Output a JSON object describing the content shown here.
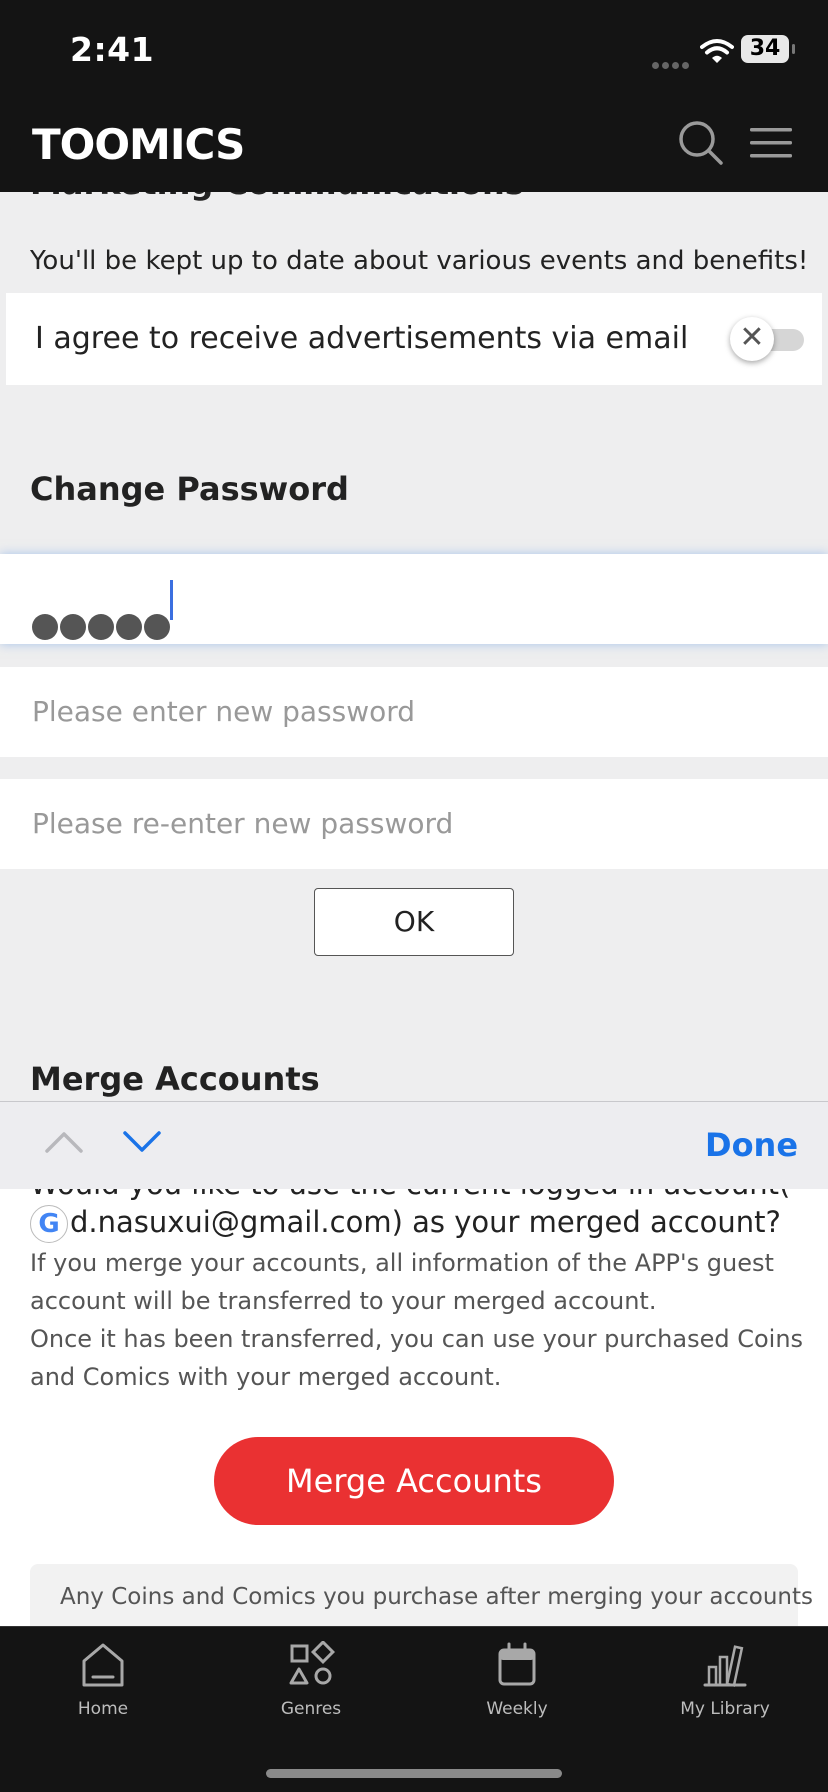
{
  "status_bar": {
    "time": "2:41",
    "battery": "34"
  },
  "header": {
    "logo": "TOOMICS"
  },
  "marketing": {
    "title": "Marketing Communications",
    "description": "You'll be kept up to date about various events and benefits!",
    "email_agree_label": "I agree to receive advertisements via email",
    "email_agree_enabled": false
  },
  "change_password": {
    "title": "Change Password",
    "current_value_masked": "•••••",
    "new_placeholder": "Please enter new password",
    "reenter_placeholder": "Please re-enter new password",
    "ok_label": "OK"
  },
  "merge": {
    "title": "Merge Accounts",
    "question_line1": "Would you like to use the current logged in account(",
    "google_letter": "G",
    "question_line2": "d.nasuxui@gmail.com) as your merged account?",
    "info": [
      "If you merge your accounts, all information of the APP's guest",
      "account will be transferred to your merged account.",
      "Once it has been transferred, you can use your purchased Coins",
      "and Comics with your merged account."
    ],
    "button_label": "Merge Accounts",
    "notice": "Any Coins and Comics you purchase after merging your accounts"
  },
  "keyboard_toolbar": {
    "done_label": "Done"
  },
  "tabbar": {
    "items": [
      {
        "label": "Home",
        "icon": "home-icon"
      },
      {
        "label": "Genres",
        "icon": "genres-icon"
      },
      {
        "label": "Weekly",
        "icon": "calendar-icon"
      },
      {
        "label": "My Library",
        "icon": "library-icon"
      }
    ]
  },
  "colors": {
    "accent_red": "#ea3132",
    "link_blue": "#1a73e8",
    "header_bg": "#141414"
  }
}
